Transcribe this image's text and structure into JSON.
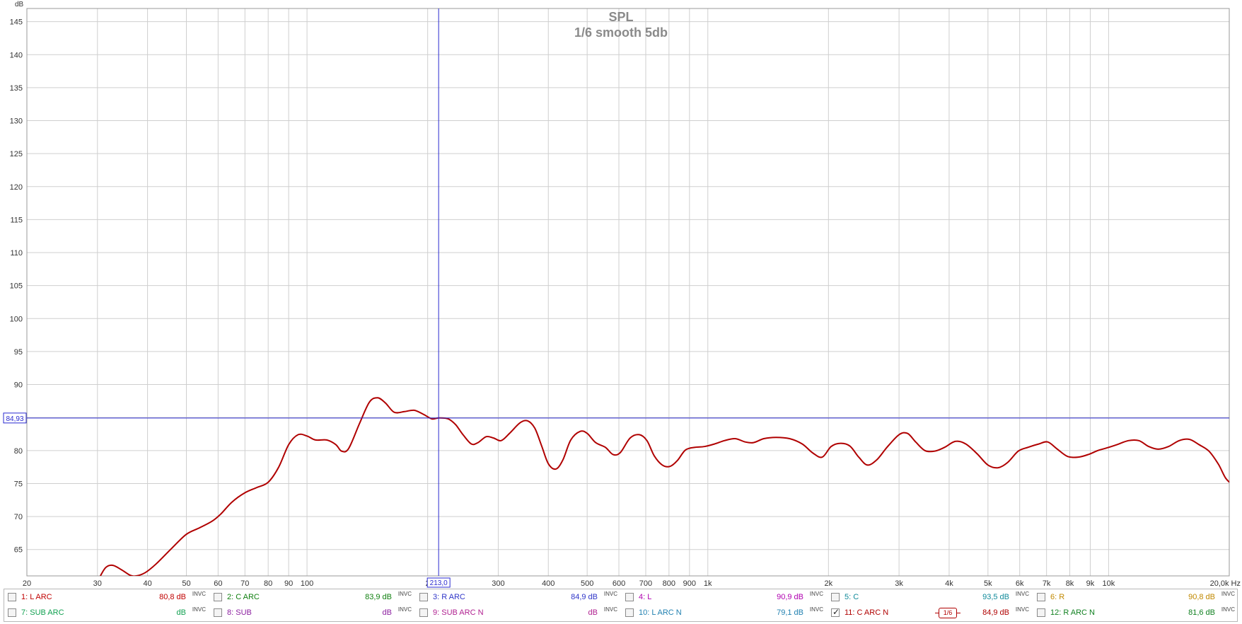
{
  "chart_data": {
    "type": "line",
    "title": "SPL",
    "subtitle": "1/6 smooth 5db",
    "ylabel": "dB",
    "xunit": "Hz",
    "x_scale": "log",
    "xlim": [
      20,
      20000
    ],
    "ylim": [
      61,
      147
    ],
    "grid": true,
    "yticks": [
      145,
      140,
      135,
      130,
      125,
      120,
      115,
      110,
      105,
      100,
      95,
      90,
      85,
      80,
      75,
      70,
      65
    ],
    "x_grid": [
      30,
      40,
      50,
      60,
      70,
      80,
      90,
      100,
      200,
      300,
      400,
      500,
      600,
      700,
      800,
      900,
      1000,
      2000,
      3000,
      4000,
      5000,
      6000,
      7000,
      8000,
      9000,
      10000
    ],
    "xtick_labels": [
      {
        "f": 20,
        "label": "20"
      },
      {
        "f": 30,
        "label": "30"
      },
      {
        "f": 40,
        "label": "40"
      },
      {
        "f": 50,
        "label": "50"
      },
      {
        "f": 60,
        "label": "60"
      },
      {
        "f": 70,
        "label": "70"
      },
      {
        "f": 80,
        "label": "80"
      },
      {
        "f": 90,
        "label": "90"
      },
      {
        "f": 100,
        "label": "100"
      },
      {
        "f": 200,
        "label": "2"
      },
      {
        "f": 300,
        "label": "300"
      },
      {
        "f": 400,
        "label": "400"
      },
      {
        "f": 500,
        "label": "500"
      },
      {
        "f": 600,
        "label": "600"
      },
      {
        "f": 700,
        "label": "700"
      },
      {
        "f": 800,
        "label": "800"
      },
      {
        "f": 900,
        "label": "900"
      },
      {
        "f": 1000,
        "label": "1k"
      },
      {
        "f": 2000,
        "label": "2k"
      },
      {
        "f": 3000,
        "label": "3k"
      },
      {
        "f": 4000,
        "label": "4k"
      },
      {
        "f": 5000,
        "label": "5k"
      },
      {
        "f": 6000,
        "label": "6k"
      },
      {
        "f": 7000,
        "label": "7k"
      },
      {
        "f": 8000,
        "label": "8k"
      },
      {
        "f": 9000,
        "label": "9k"
      },
      {
        "f": 10000,
        "label": "10k"
      },
      {
        "f": 20000,
        "label": "20,0k Hz"
      }
    ],
    "cursor": {
      "x": 213.0,
      "y": 84.93,
      "x_label": "213,0",
      "y_label": "84,93"
    },
    "series": [
      {
        "name": "11: C ARC  N",
        "color": "#b00000",
        "points": [
          [
            30.5,
            61
          ],
          [
            31.5,
            62.3
          ],
          [
            32.8,
            62.6
          ],
          [
            34.5,
            61.9
          ],
          [
            36.2,
            61.1
          ],
          [
            37.5,
            61.0
          ],
          [
            39.5,
            61.5
          ],
          [
            42,
            62.8
          ],
          [
            46,
            65.2
          ],
          [
            50,
            67.3
          ],
          [
            54,
            68.3
          ],
          [
            58,
            69.3
          ],
          [
            61,
            70.4
          ],
          [
            65,
            72.2
          ],
          [
            70,
            73.6
          ],
          [
            75,
            74.4
          ],
          [
            80,
            75.2
          ],
          [
            85,
            77.5
          ],
          [
            90,
            80.9
          ],
          [
            95,
            82.4
          ],
          [
            100,
            82.2
          ],
          [
            105,
            81.6
          ],
          [
            112,
            81.6
          ],
          [
            118,
            80.9
          ],
          [
            122,
            79.9
          ],
          [
            127,
            80.3
          ],
          [
            135,
            84.0
          ],
          [
            143,
            87.3
          ],
          [
            150,
            88.0
          ],
          [
            157,
            87.2
          ],
          [
            165,
            85.8
          ],
          [
            175,
            85.9
          ],
          [
            185,
            86.1
          ],
          [
            195,
            85.5
          ],
          [
            205,
            84.8
          ],
          [
            213,
            84.93
          ],
          [
            225,
            84.8
          ],
          [
            235,
            83.9
          ],
          [
            245,
            82.4
          ],
          [
            257,
            81.0
          ],
          [
            267,
            81.2
          ],
          [
            280,
            82.1
          ],
          [
            292,
            81.9
          ],
          [
            305,
            81.5
          ],
          [
            320,
            82.6
          ],
          [
            340,
            84.2
          ],
          [
            355,
            84.5
          ],
          [
            370,
            83.4
          ],
          [
            385,
            80.7
          ],
          [
            400,
            78.0
          ],
          [
            418,
            77.2
          ],
          [
            435,
            78.6
          ],
          [
            455,
            81.6
          ],
          [
            480,
            82.9
          ],
          [
            500,
            82.6
          ],
          [
            525,
            81.2
          ],
          [
            555,
            80.5
          ],
          [
            580,
            79.4
          ],
          [
            605,
            79.7
          ],
          [
            640,
            81.9
          ],
          [
            675,
            82.4
          ],
          [
            705,
            81.5
          ],
          [
            735,
            79.2
          ],
          [
            770,
            77.8
          ],
          [
            805,
            77.6
          ],
          [
            840,
            78.5
          ],
          [
            880,
            80.1
          ],
          [
            930,
            80.5
          ],
          [
            980,
            80.6
          ],
          [
            1040,
            81.0
          ],
          [
            1100,
            81.5
          ],
          [
            1170,
            81.8
          ],
          [
            1240,
            81.3
          ],
          [
            1300,
            81.2
          ],
          [
            1380,
            81.8
          ],
          [
            1480,
            82.0
          ],
          [
            1600,
            81.8
          ],
          [
            1720,
            81.0
          ],
          [
            1830,
            79.6
          ],
          [
            1930,
            79.0
          ],
          [
            2030,
            80.6
          ],
          [
            2140,
            81.1
          ],
          [
            2260,
            80.7
          ],
          [
            2380,
            79.0
          ],
          [
            2500,
            77.8
          ],
          [
            2640,
            78.6
          ],
          [
            2800,
            80.5
          ],
          [
            3000,
            82.4
          ],
          [
            3150,
            82.6
          ],
          [
            3300,
            81.3
          ],
          [
            3480,
            80.0
          ],
          [
            3680,
            79.9
          ],
          [
            3900,
            80.5
          ],
          [
            4150,
            81.4
          ],
          [
            4400,
            81.0
          ],
          [
            4700,
            79.5
          ],
          [
            5000,
            77.8
          ],
          [
            5300,
            77.4
          ],
          [
            5600,
            78.2
          ],
          [
            5950,
            79.9
          ],
          [
            6300,
            80.5
          ],
          [
            6700,
            81.0
          ],
          [
            7050,
            81.3
          ],
          [
            7450,
            80.2
          ],
          [
            7900,
            79.1
          ],
          [
            8400,
            79.0
          ],
          [
            8900,
            79.4
          ],
          [
            9400,
            80.0
          ],
          [
            9900,
            80.4
          ],
          [
            10500,
            80.9
          ],
          [
            11200,
            81.5
          ],
          [
            11900,
            81.5
          ],
          [
            12600,
            80.6
          ],
          [
            13300,
            80.2
          ],
          [
            14100,
            80.6
          ],
          [
            15000,
            81.5
          ],
          [
            15900,
            81.7
          ],
          [
            16800,
            80.9
          ],
          [
            17800,
            79.9
          ],
          [
            18800,
            77.9
          ],
          [
            19600,
            75.8
          ],
          [
            20500,
            74.7
          ],
          [
            21000,
            74.5
          ]
        ]
      }
    ]
  },
  "legend": [
    {
      "name": "1: L ARC",
      "value": "80,8 dB",
      "inv": "INVC",
      "color": "#c00000",
      "checked": false
    },
    {
      "name": "2: C ARC",
      "value": "83,9 dB",
      "inv": "INVC",
      "color": "#108010",
      "checked": false
    },
    {
      "name": "3: R  ARC",
      "value": "84,9 dB",
      "inv": "INVC",
      "color": "#2f35c8",
      "checked": false
    },
    {
      "name": "4: L",
      "value": "90,9 dB",
      "inv": "INVC",
      "color": "#b000b0",
      "checked": false
    },
    {
      "name": "5: C",
      "value": "93,5 dB",
      "inv": "INVC",
      "color": "#108a9a",
      "checked": false
    },
    {
      "name": "6: R",
      "value": "90,8 dB",
      "inv": "INVC",
      "color": "#c08800",
      "checked": false
    },
    {
      "name": "7: SUB ARC",
      "value": "dB",
      "inv": "INVC",
      "color": "#10a050",
      "checked": false
    },
    {
      "name": "8: SUB",
      "value": "dB",
      "inv": "INVC",
      "color": "#8c20a0",
      "checked": false
    },
    {
      "name": "9: SUB ARC N",
      "value": "dB",
      "inv": "INVC",
      "color": "#b02090",
      "checked": false
    },
    {
      "name": "10: L ARC N",
      "value": "79,1 dB",
      "inv": "INVC",
      "color": "#2080b0",
      "checked": false
    },
    {
      "name": "11: C ARC  N",
      "value": "84,9 dB",
      "inv": "INVC",
      "color": "#b00000",
      "checked": true,
      "badge": "1/6"
    },
    {
      "name": "12: R ARC  N",
      "value": "81,6 dB",
      "inv": "INVC",
      "color": "#108020",
      "checked": false
    }
  ]
}
